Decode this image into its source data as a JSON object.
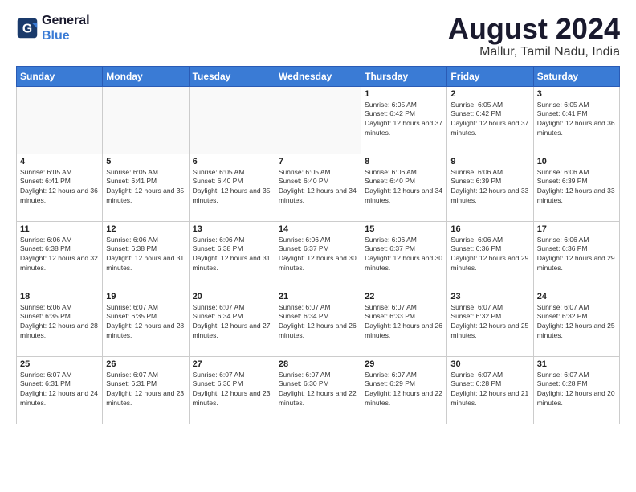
{
  "header": {
    "logo_line1": "General",
    "logo_line2": "Blue",
    "title": "August 2024",
    "subtitle": "Mallur, Tamil Nadu, India"
  },
  "days_of_week": [
    "Sunday",
    "Monday",
    "Tuesday",
    "Wednesday",
    "Thursday",
    "Friday",
    "Saturday"
  ],
  "weeks": [
    [
      {
        "day": "",
        "empty": true
      },
      {
        "day": "",
        "empty": true
      },
      {
        "day": "",
        "empty": true
      },
      {
        "day": "",
        "empty": true
      },
      {
        "day": "1",
        "sunrise": "Sunrise: 6:05 AM",
        "sunset": "Sunset: 6:42 PM",
        "daylight": "Daylight: 12 hours and 37 minutes."
      },
      {
        "day": "2",
        "sunrise": "Sunrise: 6:05 AM",
        "sunset": "Sunset: 6:42 PM",
        "daylight": "Daylight: 12 hours and 37 minutes."
      },
      {
        "day": "3",
        "sunrise": "Sunrise: 6:05 AM",
        "sunset": "Sunset: 6:41 PM",
        "daylight": "Daylight: 12 hours and 36 minutes."
      }
    ],
    [
      {
        "day": "4",
        "sunrise": "Sunrise: 6:05 AM",
        "sunset": "Sunset: 6:41 PM",
        "daylight": "Daylight: 12 hours and 36 minutes."
      },
      {
        "day": "5",
        "sunrise": "Sunrise: 6:05 AM",
        "sunset": "Sunset: 6:41 PM",
        "daylight": "Daylight: 12 hours and 35 minutes."
      },
      {
        "day": "6",
        "sunrise": "Sunrise: 6:05 AM",
        "sunset": "Sunset: 6:40 PM",
        "daylight": "Daylight: 12 hours and 35 minutes."
      },
      {
        "day": "7",
        "sunrise": "Sunrise: 6:05 AM",
        "sunset": "Sunset: 6:40 PM",
        "daylight": "Daylight: 12 hours and 34 minutes."
      },
      {
        "day": "8",
        "sunrise": "Sunrise: 6:06 AM",
        "sunset": "Sunset: 6:40 PM",
        "daylight": "Daylight: 12 hours and 34 minutes."
      },
      {
        "day": "9",
        "sunrise": "Sunrise: 6:06 AM",
        "sunset": "Sunset: 6:39 PM",
        "daylight": "Daylight: 12 hours and 33 minutes."
      },
      {
        "day": "10",
        "sunrise": "Sunrise: 6:06 AM",
        "sunset": "Sunset: 6:39 PM",
        "daylight": "Daylight: 12 hours and 33 minutes."
      }
    ],
    [
      {
        "day": "11",
        "sunrise": "Sunrise: 6:06 AM",
        "sunset": "Sunset: 6:38 PM",
        "daylight": "Daylight: 12 hours and 32 minutes."
      },
      {
        "day": "12",
        "sunrise": "Sunrise: 6:06 AM",
        "sunset": "Sunset: 6:38 PM",
        "daylight": "Daylight: 12 hours and 31 minutes."
      },
      {
        "day": "13",
        "sunrise": "Sunrise: 6:06 AM",
        "sunset": "Sunset: 6:38 PM",
        "daylight": "Daylight: 12 hours and 31 minutes."
      },
      {
        "day": "14",
        "sunrise": "Sunrise: 6:06 AM",
        "sunset": "Sunset: 6:37 PM",
        "daylight": "Daylight: 12 hours and 30 minutes."
      },
      {
        "day": "15",
        "sunrise": "Sunrise: 6:06 AM",
        "sunset": "Sunset: 6:37 PM",
        "daylight": "Daylight: 12 hours and 30 minutes."
      },
      {
        "day": "16",
        "sunrise": "Sunrise: 6:06 AM",
        "sunset": "Sunset: 6:36 PM",
        "daylight": "Daylight: 12 hours and 29 minutes."
      },
      {
        "day": "17",
        "sunrise": "Sunrise: 6:06 AM",
        "sunset": "Sunset: 6:36 PM",
        "daylight": "Daylight: 12 hours and 29 minutes."
      }
    ],
    [
      {
        "day": "18",
        "sunrise": "Sunrise: 6:06 AM",
        "sunset": "Sunset: 6:35 PM",
        "daylight": "Daylight: 12 hours and 28 minutes."
      },
      {
        "day": "19",
        "sunrise": "Sunrise: 6:07 AM",
        "sunset": "Sunset: 6:35 PM",
        "daylight": "Daylight: 12 hours and 28 minutes."
      },
      {
        "day": "20",
        "sunrise": "Sunrise: 6:07 AM",
        "sunset": "Sunset: 6:34 PM",
        "daylight": "Daylight: 12 hours and 27 minutes."
      },
      {
        "day": "21",
        "sunrise": "Sunrise: 6:07 AM",
        "sunset": "Sunset: 6:34 PM",
        "daylight": "Daylight: 12 hours and 26 minutes."
      },
      {
        "day": "22",
        "sunrise": "Sunrise: 6:07 AM",
        "sunset": "Sunset: 6:33 PM",
        "daylight": "Daylight: 12 hours and 26 minutes."
      },
      {
        "day": "23",
        "sunrise": "Sunrise: 6:07 AM",
        "sunset": "Sunset: 6:32 PM",
        "daylight": "Daylight: 12 hours and 25 minutes."
      },
      {
        "day": "24",
        "sunrise": "Sunrise: 6:07 AM",
        "sunset": "Sunset: 6:32 PM",
        "daylight": "Daylight: 12 hours and 25 minutes."
      }
    ],
    [
      {
        "day": "25",
        "sunrise": "Sunrise: 6:07 AM",
        "sunset": "Sunset: 6:31 PM",
        "daylight": "Daylight: 12 hours and 24 minutes."
      },
      {
        "day": "26",
        "sunrise": "Sunrise: 6:07 AM",
        "sunset": "Sunset: 6:31 PM",
        "daylight": "Daylight: 12 hours and 23 minutes."
      },
      {
        "day": "27",
        "sunrise": "Sunrise: 6:07 AM",
        "sunset": "Sunset: 6:30 PM",
        "daylight": "Daylight: 12 hours and 23 minutes."
      },
      {
        "day": "28",
        "sunrise": "Sunrise: 6:07 AM",
        "sunset": "Sunset: 6:30 PM",
        "daylight": "Daylight: 12 hours and 22 minutes."
      },
      {
        "day": "29",
        "sunrise": "Sunrise: 6:07 AM",
        "sunset": "Sunset: 6:29 PM",
        "daylight": "Daylight: 12 hours and 22 minutes."
      },
      {
        "day": "30",
        "sunrise": "Sunrise: 6:07 AM",
        "sunset": "Sunset: 6:28 PM",
        "daylight": "Daylight: 12 hours and 21 minutes."
      },
      {
        "day": "31",
        "sunrise": "Sunrise: 6:07 AM",
        "sunset": "Sunset: 6:28 PM",
        "daylight": "Daylight: 12 hours and 20 minutes."
      }
    ]
  ]
}
